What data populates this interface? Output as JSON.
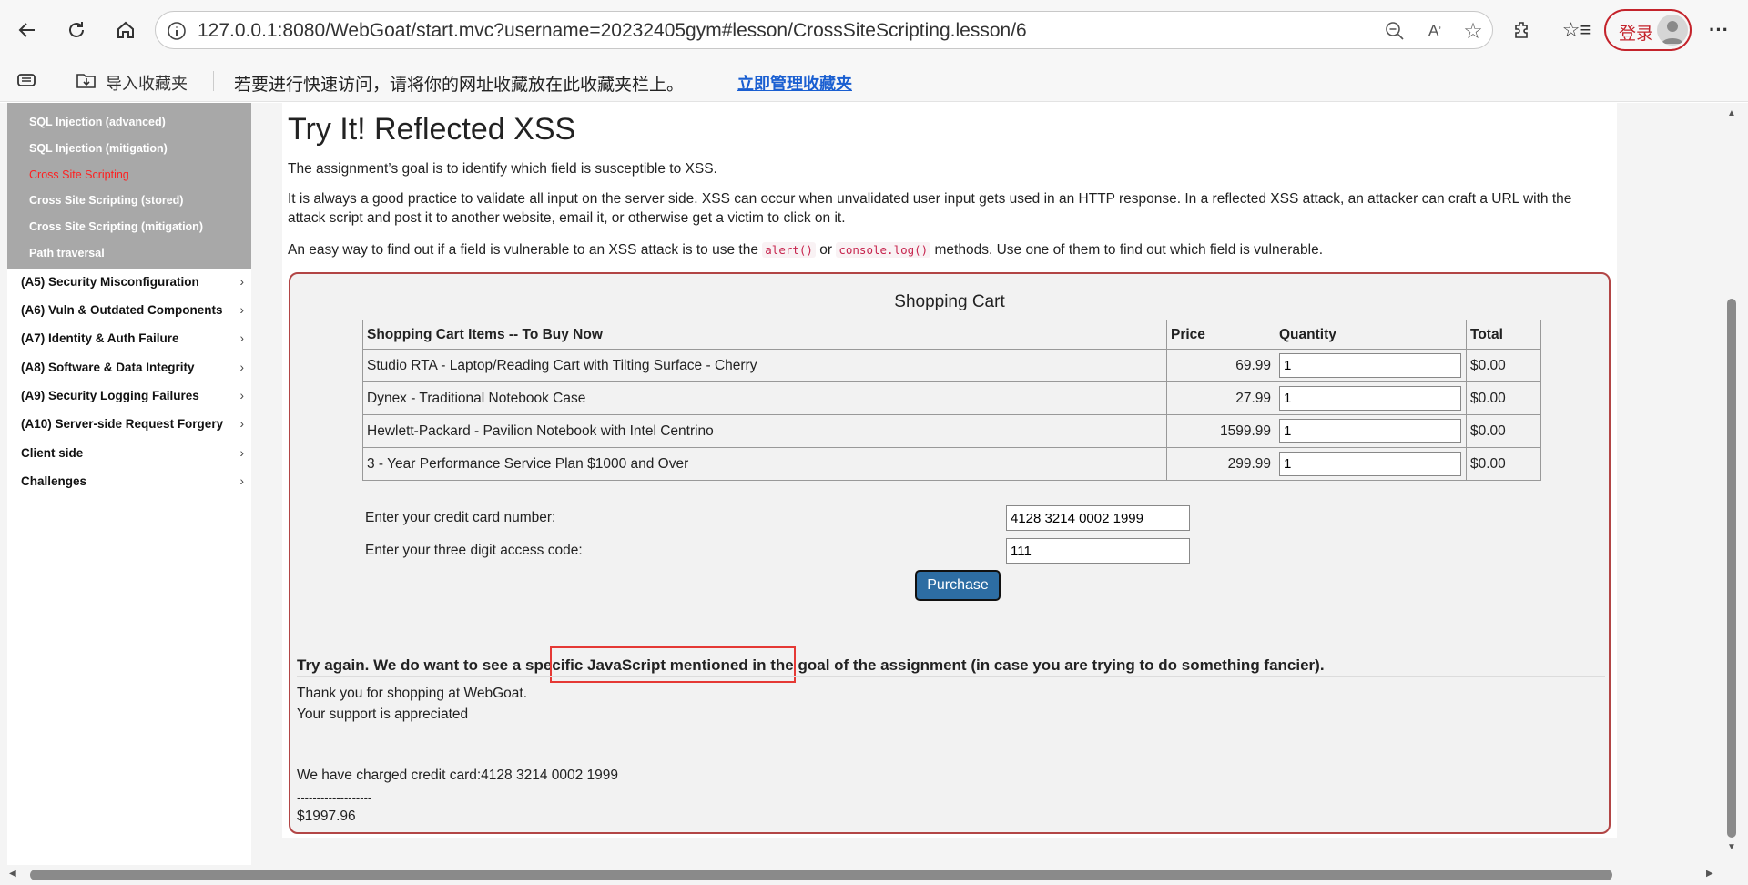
{
  "browser": {
    "url": "127.0.0.1:8080/WebGoat/start.mvc?username=20232405gym#lesson/CrossSiteScripting.lesson/6",
    "login_label": "登录",
    "icons": [
      "back-icon",
      "refresh-icon",
      "home-icon",
      "info-icon",
      "zoom-out-icon",
      "read-aloud-icon",
      "favorite-star-icon",
      "extensions-icon",
      "favorites-icon",
      "avatar-icon",
      "more-icon"
    ]
  },
  "favorites_bar": {
    "import_label": "导入收藏夹",
    "hint_text": "若要进行快速访问，请将你的网址收藏放在此收藏夹栏上。",
    "manage_link": "立即管理收藏夹"
  },
  "sidebar": {
    "sub_items": [
      {
        "label": "SQL Injection (advanced)",
        "active": false
      },
      {
        "label": "SQL Injection (mitigation)",
        "active": false
      },
      {
        "label": "Cross Site Scripting",
        "active": true
      },
      {
        "label": "Cross Site Scripting (stored)",
        "active": false
      },
      {
        "label": "Cross Site Scripting (mitigation)",
        "active": false
      },
      {
        "label": "Path traversal",
        "active": false
      }
    ],
    "categories": [
      {
        "label": "(A5) Security Misconfiguration"
      },
      {
        "label": "(A6) Vuln & Outdated Components"
      },
      {
        "label": "(A7) Identity & Auth Failure"
      },
      {
        "label": "(A8) Software & Data Integrity"
      },
      {
        "label": "(A9) Security Logging Failures"
      },
      {
        "label": "(A10) Server-side Request Forgery"
      },
      {
        "label": "Client side"
      },
      {
        "label": "Challenges"
      }
    ],
    "chevron": "›"
  },
  "lesson": {
    "title": "Try It! Reflected XSS",
    "p1": "The assignment’s goal is to identify which field is susceptible to XSS.",
    "p2": "It is always a good practice to validate all input on the server side. XSS can occur when unvalidated user input gets used in an HTTP response. In a reflected XSS attack, an attacker can craft a URL with the attack script and post it to another website, email it, or otherwise get a victim to click on it.",
    "p3_before": "An easy way to find out if a field is vulnerable to an XSS attack is to use the ",
    "p3_code1": "alert()",
    "p3_or": " or ",
    "p3_code2": "console.log()",
    "p3_after": " methods. Use one of them to find out which field is vulnerable."
  },
  "cart": {
    "title": "Shopping Cart",
    "headers": [
      "Shopping Cart Items -- To Buy Now",
      "Price",
      "Quantity",
      "Total"
    ],
    "rows": [
      {
        "item": "Studio RTA - Laptop/Reading Cart with Tilting Surface - Cherry",
        "price": "69.99",
        "qty": "1",
        "total": "$0.00"
      },
      {
        "item": "Dynex - Traditional Notebook Case",
        "price": "27.99",
        "qty": "1",
        "total": "$0.00"
      },
      {
        "item": "Hewlett-Packard - Pavilion Notebook with Intel Centrino",
        "price": "1599.99",
        "qty": "1",
        "total": "$0.00"
      },
      {
        "item": "3 - Year Performance Service Plan $1000 and Over",
        "price": "299.99",
        "qty": "1",
        "total": "$0.00"
      }
    ],
    "cc_label": "Enter your credit card number:",
    "cc_value": "4128 3214 0002 1999",
    "code_label": "Enter your three digit access code:",
    "code_value": "111",
    "purchase_label": "Purchase"
  },
  "feedback": {
    "before": "Try again. We do want to see a ",
    "highlight": "specific JavaScript mentioned",
    "after": " in the goal of the assignment (in case you are trying to do something fancier)."
  },
  "output": {
    "line1": "Thank you for shopping at WebGoat.",
    "line2": "Your support is appreciated",
    "line3": "We have charged credit card:4128 3214 0002 1999",
    "line4": "-------------------",
    "line5": "$1997.96"
  },
  "colors": {
    "active_link": "#ff2020",
    "box_border": "#b24545",
    "purchase_button": "#2d6da3",
    "highlight_border": "#e53935",
    "manage_link": "#1a5fd1"
  }
}
